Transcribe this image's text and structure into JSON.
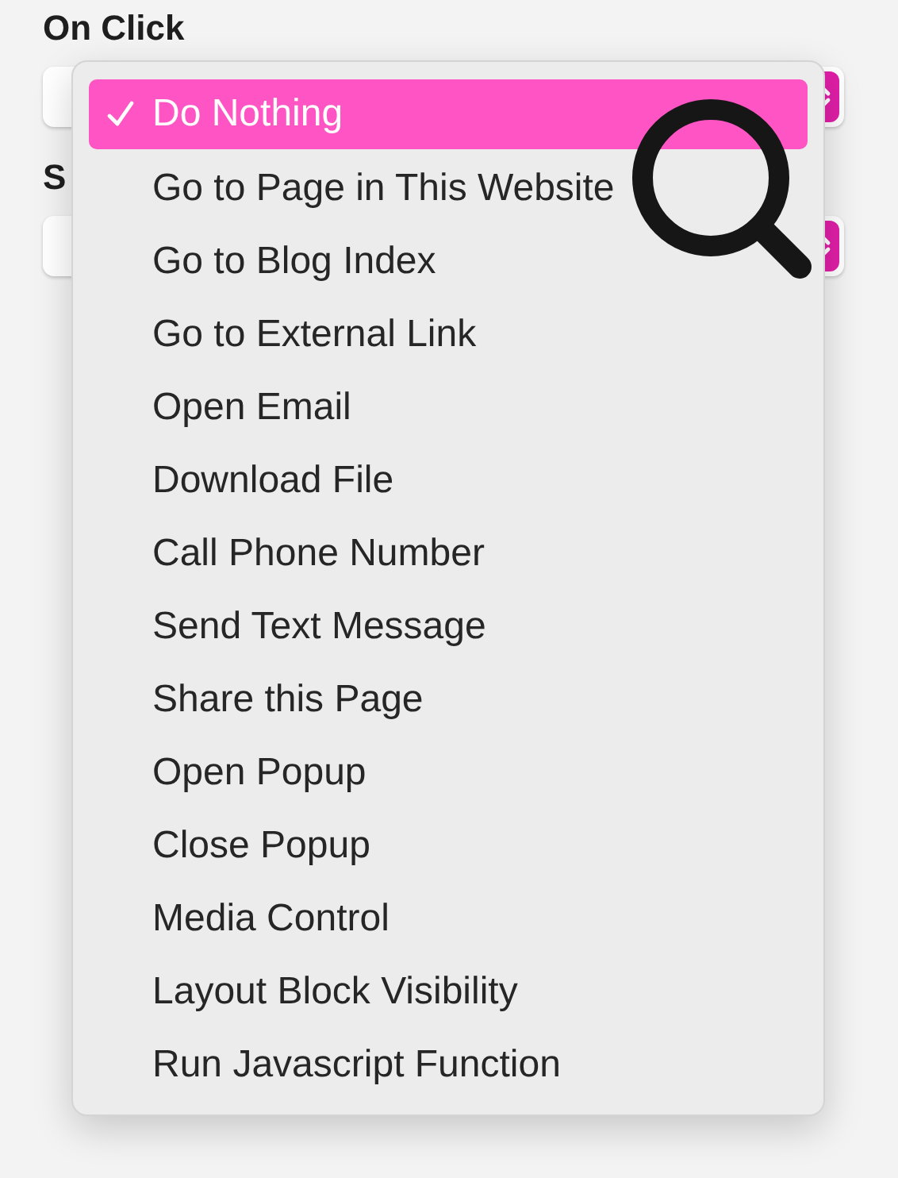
{
  "sections": [
    {
      "label": "On Click"
    },
    {
      "label": "S"
    }
  ],
  "menu": {
    "items": [
      {
        "label": "Do Nothing",
        "selected": true
      },
      {
        "label": "Go to Page in This Website",
        "selected": false
      },
      {
        "label": "Go to Blog Index",
        "selected": false
      },
      {
        "label": "Go to External Link",
        "selected": false
      },
      {
        "label": "Open Email",
        "selected": false
      },
      {
        "label": "Download File",
        "selected": false
      },
      {
        "label": "Call Phone Number",
        "selected": false
      },
      {
        "label": "Send Text Message",
        "selected": false
      },
      {
        "label": "Share this Page",
        "selected": false
      },
      {
        "label": "Open Popup",
        "selected": false
      },
      {
        "label": "Close Popup",
        "selected": false
      },
      {
        "label": "Media Control",
        "selected": false
      },
      {
        "label": "Layout Block Visibility",
        "selected": false
      },
      {
        "label": "Run Javascript Function",
        "selected": false
      }
    ]
  }
}
